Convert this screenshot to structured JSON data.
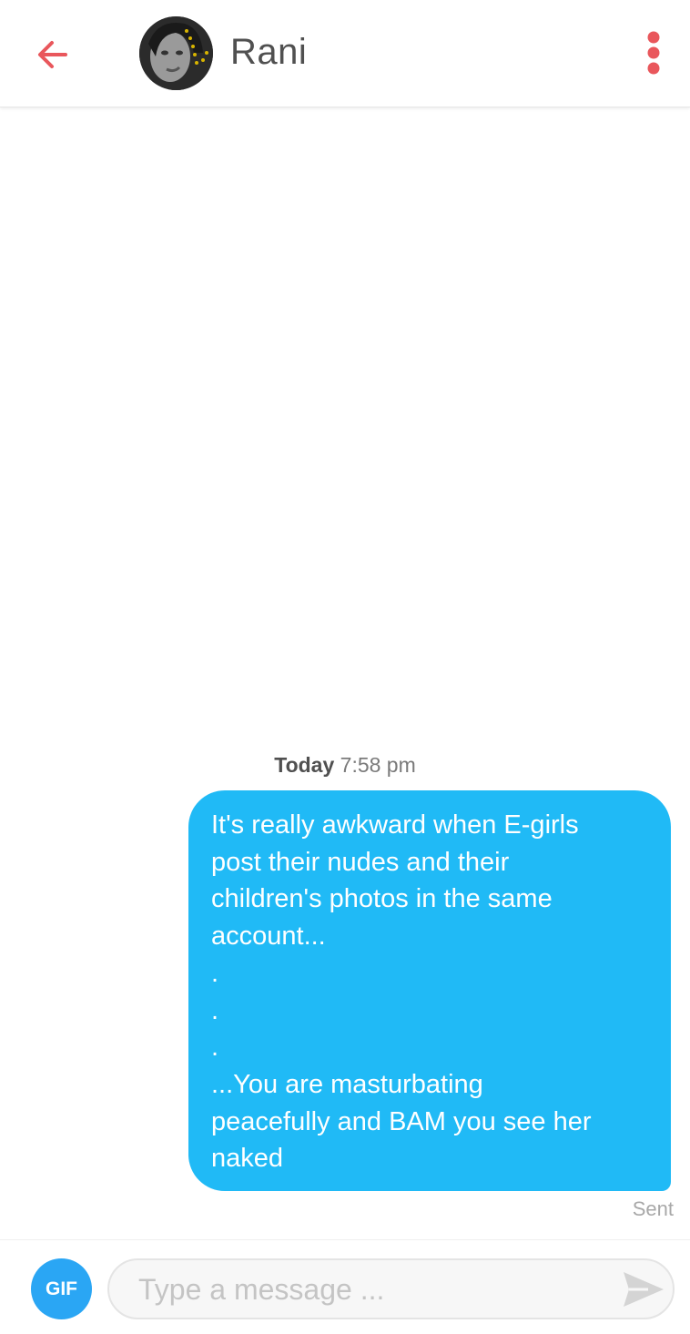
{
  "header": {
    "contact_name": "Rani",
    "accent_color": "#e9575c"
  },
  "chat": {
    "timestamp_day": "Today",
    "timestamp_time": "7:58 pm",
    "message": {
      "lines": [
        "It's really awkward when E-girls",
        "post their nudes and their",
        "children's photos in the same",
        "account...",
        ".",
        ".",
        ".",
        "...You are masturbating",
        "peacefully and BAM you see her",
        "naked"
      ],
      "bubble_color": "#20baf6"
    },
    "status": "Sent"
  },
  "composer": {
    "gif_label": "GIF",
    "placeholder": "Type a message ..."
  },
  "icons": {
    "back": "arrow-left-icon",
    "menu": "kebab-menu-icon",
    "send": "send-icon"
  }
}
